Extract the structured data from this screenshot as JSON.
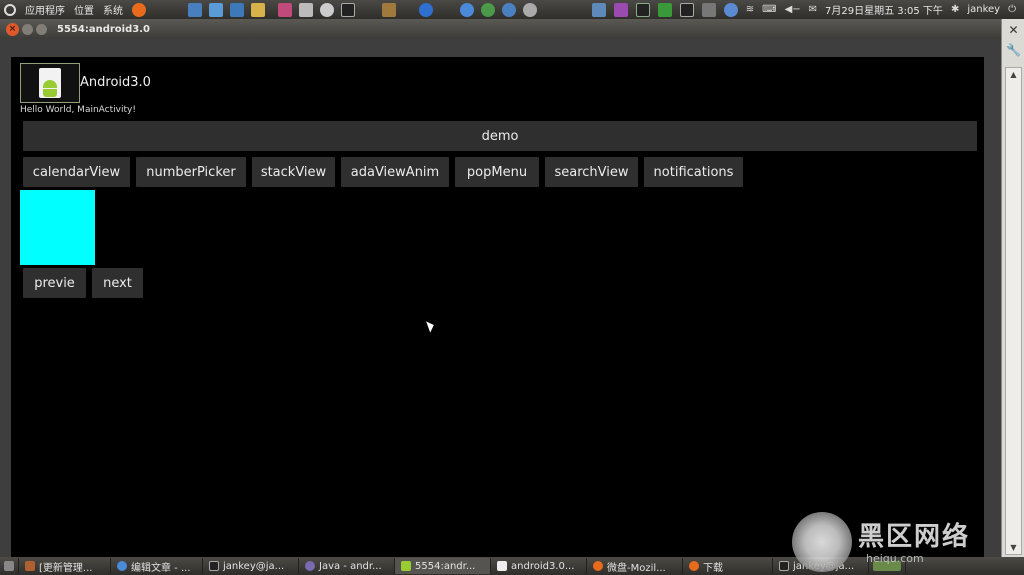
{
  "top_panel": {
    "menu": [
      "应用程序",
      "位置",
      "系统"
    ],
    "clock": "7月29日星期五 3:05 下午",
    "user": "jankey"
  },
  "window": {
    "title": "5554:android3.0"
  },
  "app": {
    "title": "Android3.0",
    "hello": "Hello World, MainActivity!",
    "demo_label": "demo",
    "row_buttons": [
      "calendarView",
      "numberPicker",
      "stackView",
      "adaViewAnim",
      "popMenu",
      "searchView",
      "notifications"
    ],
    "nav_buttons": [
      "previe",
      "next"
    ],
    "box_color": "#00ffff"
  },
  "taskbar": {
    "items": [
      "[更新管理...",
      "编辑文章 - ...",
      "jankey@ja...",
      "Java - andr...",
      "5554:andr...",
      "android3.0...",
      "微盘-Mozil...",
      "下载",
      "jankey@ja..."
    ]
  },
  "watermark": {
    "text": "黑区网络",
    "sub": "heiqu.com"
  }
}
